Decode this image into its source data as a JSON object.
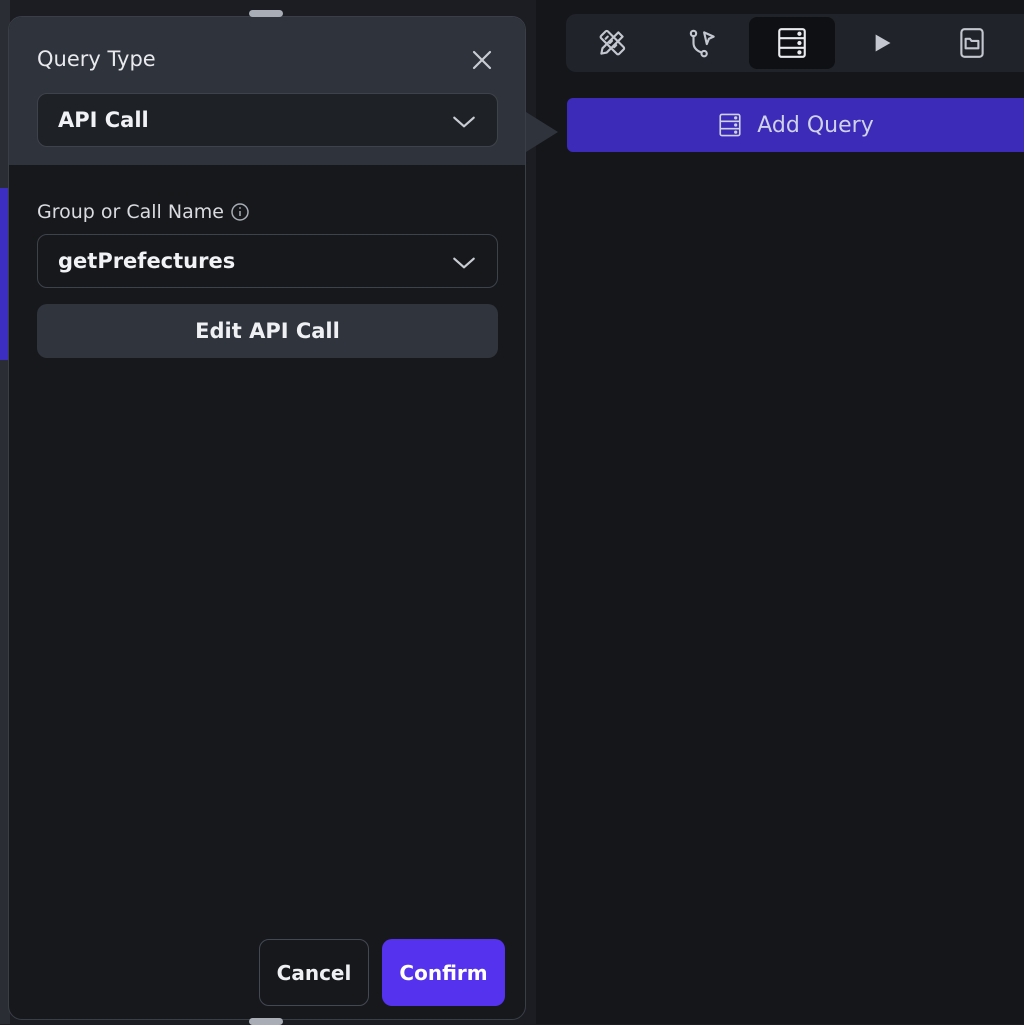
{
  "toolbar": {
    "tools": [
      {
        "icon": "ruler-pencil-icon"
      },
      {
        "icon": "branch-cursor-icon"
      },
      {
        "icon": "database-icon",
        "active": true
      },
      {
        "icon": "play-icon"
      },
      {
        "icon": "folder-icon"
      }
    ]
  },
  "add_query": {
    "label": "Add Query",
    "icon": "database-icon",
    "color": "#3b2bb8"
  },
  "panel": {
    "title": "Query Type",
    "query_type": {
      "selected": "API Call"
    },
    "call_name": {
      "label": "Group or Call Name",
      "selected": "getPrefectures"
    },
    "edit_button": "Edit API Call",
    "cancel_button": "Cancel",
    "confirm_button": "Confirm",
    "confirm_color": "#5533ee"
  }
}
